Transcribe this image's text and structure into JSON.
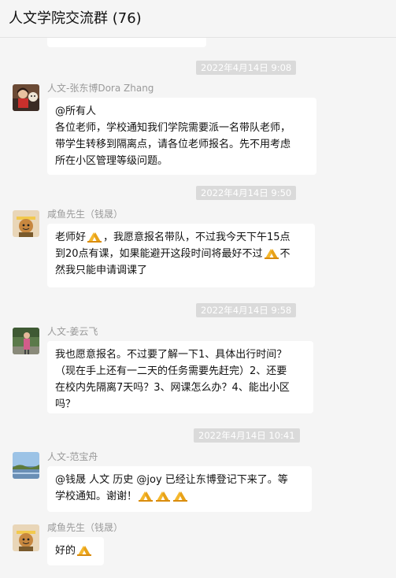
{
  "window": {
    "title": "人文学院交流群 (76)"
  },
  "messages": [
    {
      "timestamp": "2022年4月14日 9:08",
      "sender": "人文-张东博Dora Zhang",
      "avatar_icon": "photo-avatar-person",
      "lines": [
        [
          "@所有人"
        ],
        [
          "各位老师，学校通知我们学院需要派一名带队老师，"
        ],
        [
          "带学生转移到隔离点，请各位老师报名。先不用考虑"
        ],
        [
          "所在小区管理等级问题。"
        ]
      ]
    },
    {
      "timestamp": "2022年4月14日 9:50",
      "sender": "咸鱼先生（钱晟）",
      "avatar_icon": "cartoon-avatar",
      "lines": [
        [
          "老师好",
          "[pray]",
          "，我愿意报名带队，不过我今天下午15点"
        ],
        [
          "到20点有课，如果能避开这段时间将最好不过",
          "[pray]",
          "不"
        ],
        [
          "然我只能申请调课了"
        ]
      ]
    },
    {
      "timestamp": "2022年4月14日 9:58",
      "sender": "人文-姜云飞",
      "avatar_icon": "photo-avatar-outdoor",
      "lines": [
        [
          "我也愿意报名。不过要了解一下1、具体出行时间？"
        ],
        [
          "（现在手上还有一二天的任务需要先赶完）2、还要"
        ],
        [
          "在校内先隔离7天吗？3、网课怎么办？4、能出小区"
        ],
        [
          "吗？"
        ]
      ]
    },
    {
      "timestamp": "2022年4月14日 10:41",
      "sender": "人文-范宝舟",
      "avatar_icon": "photo-avatar-landscape",
      "lines": [
        [
          "@钱晟 人文 历史 @joy 已经让东博登记下来了。等"
        ],
        [
          "学校通知。谢谢！",
          "[pray]",
          "[pray]",
          "[pray]"
        ]
      ]
    },
    {
      "timestamp": "",
      "sender": "咸鱼先生（钱晟）",
      "avatar_icon": "cartoon-avatar",
      "lines": [
        [
          "好的",
          "[pray]"
        ]
      ]
    }
  ],
  "emoji": {
    "pray": "pray-hands-emoji"
  },
  "colors": {
    "background": "#f5f5f5",
    "bubble": "#ffffff",
    "timestamp_bg": "#dadada",
    "sender_text": "#9a9a9a",
    "emoji_yellow": "#f5b82e"
  }
}
